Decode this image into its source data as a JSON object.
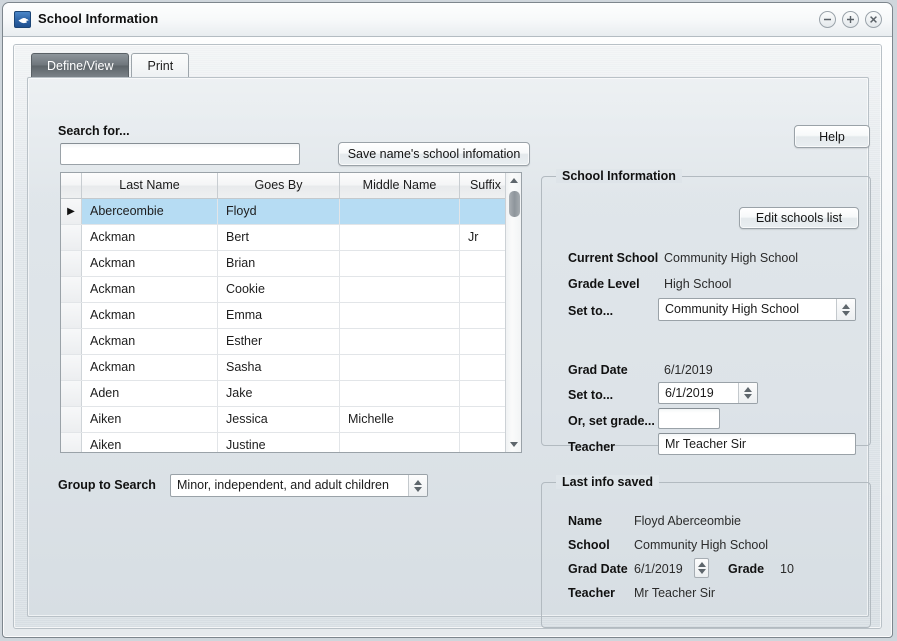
{
  "window": {
    "title": "School Information",
    "icon": "dove-icon",
    "buttons": {
      "minimize": "minimize-icon",
      "maximize": "maximize-icon",
      "close": "close-icon"
    }
  },
  "tabs": [
    {
      "label": "Define/View",
      "active": true
    },
    {
      "label": "Print",
      "active": false
    }
  ],
  "search": {
    "label": "Search for...",
    "value": "",
    "placeholder": ""
  },
  "buttons": {
    "save_school_info": "Save name's school infomation",
    "help": "Help",
    "edit_schools_list": "Edit schools list"
  },
  "table": {
    "columns": [
      "",
      "Last Name",
      "Goes By",
      "Middle Name",
      "Suffix"
    ],
    "rows": [
      {
        "marker": "▶",
        "last_name": "Aberceombie",
        "goes_by": "Floyd",
        "middle_name": "",
        "suffix": "",
        "selected": true
      },
      {
        "marker": "",
        "last_name": "Ackman",
        "goes_by": "Bert",
        "middle_name": "",
        "suffix": "Jr",
        "selected": false
      },
      {
        "marker": "",
        "last_name": "Ackman",
        "goes_by": "Brian",
        "middle_name": "",
        "suffix": "",
        "selected": false
      },
      {
        "marker": "",
        "last_name": "Ackman",
        "goes_by": "Cookie",
        "middle_name": "",
        "suffix": "",
        "selected": false
      },
      {
        "marker": "",
        "last_name": "Ackman",
        "goes_by": "Emma",
        "middle_name": "",
        "suffix": "",
        "selected": false
      },
      {
        "marker": "",
        "last_name": "Ackman",
        "goes_by": "Esther",
        "middle_name": "",
        "suffix": "",
        "selected": false
      },
      {
        "marker": "",
        "last_name": "Ackman",
        "goes_by": "Sasha",
        "middle_name": "",
        "suffix": "",
        "selected": false
      },
      {
        "marker": "",
        "last_name": "Aden",
        "goes_by": "Jake",
        "middle_name": "",
        "suffix": "",
        "selected": false
      },
      {
        "marker": "",
        "last_name": "Aiken",
        "goes_by": "Jessica",
        "middle_name": "Michelle",
        "suffix": "",
        "selected": false
      },
      {
        "marker": "",
        "last_name": "Aiken",
        "goes_by": "Justine",
        "middle_name": "",
        "suffix": "",
        "selected": false
      }
    ],
    "scrollbar": {
      "up_icon": "triangle-up-icon",
      "down_icon": "triangle-down-icon"
    }
  },
  "group_to_search": {
    "label": "Group to Search",
    "value": "Minor, independent, and adult children"
  },
  "school_information": {
    "title": "School Information",
    "current_school_label": "Current School",
    "current_school_value": "Community High School",
    "grade_level_label": "Grade Level",
    "grade_level_value": "High School",
    "set_school_label": "Set to...",
    "set_school_value": "Community High School",
    "grad_date_label": "Grad Date",
    "grad_date_value": "6/1/2019",
    "set_grad_label": "Set to...",
    "set_grad_value": "6/1/2019",
    "set_grade_label": "Or, set grade...",
    "set_grade_value": "",
    "teacher_label": "Teacher",
    "teacher_value": "Mr Teacher Sir"
  },
  "last_info_saved": {
    "title": "Last info saved",
    "name_label": "Name",
    "name_value": "Floyd Aberceombie",
    "school_label": "School",
    "school_value": "Community High School",
    "grad_date_label": "Grad Date",
    "grad_date_value": "6/1/2019",
    "grade_label": "Grade",
    "grade_value": "10",
    "teacher_label": "Teacher",
    "teacher_value": "Mr Teacher Sir"
  },
  "colors": {
    "selection": "#b6dcf3",
    "title_icon": "#2f66a8",
    "window_bg": "#e0e6ea",
    "active_tab": "#6f767c"
  }
}
